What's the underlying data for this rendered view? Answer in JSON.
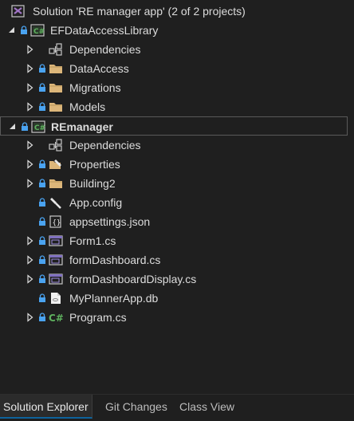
{
  "tree": [
    {
      "label": "Solution 'RE manager app' (2 of 2 projects)",
      "icon": "solution-icon",
      "level": 0,
      "arrow": "none",
      "lock": false
    },
    {
      "label": "EFDataAccessLibrary",
      "icon": "csharp-project-icon",
      "level": 0,
      "arrow": "expanded",
      "lock": true
    },
    {
      "label": "Dependencies",
      "icon": "dependencies-icon",
      "level": 1,
      "arrow": "collapsed",
      "lock": false
    },
    {
      "label": "DataAccess",
      "icon": "folder-icon",
      "level": 1,
      "arrow": "collapsed",
      "lock": true
    },
    {
      "label": "Migrations",
      "icon": "folder-icon",
      "level": 1,
      "arrow": "collapsed",
      "lock": true
    },
    {
      "label": "Models",
      "icon": "folder-icon",
      "level": 1,
      "arrow": "collapsed",
      "lock": true
    },
    {
      "label": "REmanager",
      "icon": "csharp-project-icon",
      "level": 0,
      "arrow": "expanded",
      "lock": true,
      "bold": true,
      "selected": true
    },
    {
      "label": "Dependencies",
      "icon": "dependencies-icon",
      "level": 1,
      "arrow": "collapsed",
      "lock": false
    },
    {
      "label": "Properties",
      "icon": "properties-icon",
      "level": 1,
      "arrow": "collapsed",
      "lock": true
    },
    {
      "label": "Building2",
      "icon": "folder-icon",
      "level": 1,
      "arrow": "collapsed",
      "lock": true
    },
    {
      "label": "App.config",
      "icon": "config-icon",
      "level": 1,
      "arrow": "none",
      "lock": true
    },
    {
      "label": "appsettings.json",
      "icon": "json-icon",
      "level": 1,
      "arrow": "none",
      "lock": true
    },
    {
      "label": "Form1.cs",
      "icon": "form-icon",
      "level": 1,
      "arrow": "collapsed",
      "lock": true
    },
    {
      "label": "formDashboard.cs",
      "icon": "form-icon",
      "level": 1,
      "arrow": "collapsed",
      "lock": true
    },
    {
      "label": "formDashboardDisplay.cs",
      "icon": "form-icon",
      "level": 1,
      "arrow": "collapsed",
      "lock": true
    },
    {
      "label": "MyPlannerApp.db",
      "icon": "database-file-icon",
      "level": 1,
      "arrow": "none",
      "lock": true
    },
    {
      "label": "Program.cs",
      "icon": "csharp-file-icon",
      "level": 1,
      "arrow": "collapsed",
      "lock": true
    }
  ],
  "tabs": [
    {
      "label": "Solution Explorer",
      "active": true
    },
    {
      "label": "Git Changes",
      "active": false
    },
    {
      "label": "Class View",
      "active": false
    }
  ],
  "colors": {
    "background": "#1f1f1f",
    "text": "#dcdcdc",
    "lock": "#4aa3f0",
    "folder": "#dcb67a",
    "csharp_green": "#5fb25f",
    "solution_purple": "#a074c4"
  }
}
